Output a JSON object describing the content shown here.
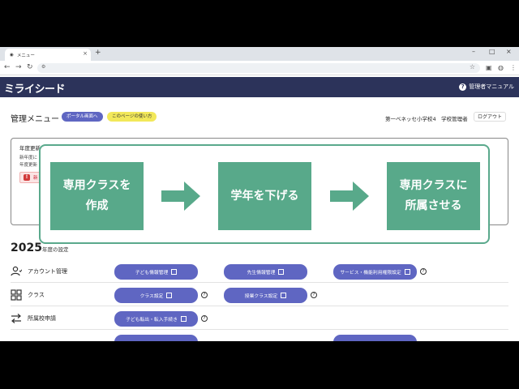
{
  "browser": {
    "tab_title": "メニュー",
    "new_tab": "+"
  },
  "app": {
    "logo": "ミライシード",
    "manual_label": "管理者マニュアル"
  },
  "header": {
    "title": "管理メニュー",
    "portal_button": "ポータル画面へ",
    "howto_button": "このページの使い方",
    "school": "第一ベネッセ小学校4　学校管理者",
    "logout": "ログアウト"
  },
  "year_update": {
    "title": "年度更新",
    "line1": "新年度に",
    "line2": "年度更新",
    "warn_text": "新"
  },
  "flow": {
    "step1_line1": "専用クラスを",
    "step1_line2": "作成",
    "step2_line1": "学年を下げる",
    "step3_line1": "専用クラスに",
    "step3_line2": "所属させる",
    "accent_color": "#58a98a"
  },
  "settings": {
    "year": "2025",
    "year_suffix": "年度の設定",
    "rows": [
      {
        "label": "アカウント管理",
        "buttons": [
          "子ども情報管理",
          "先生情報管理",
          "サービス・機能利用権限設定"
        ]
      },
      {
        "label": "クラス",
        "buttons": [
          "クラス設定",
          "授業クラス設定"
        ]
      },
      {
        "label": "所属校申請",
        "buttons": [
          "子ども転出・転入手続き"
        ]
      }
    ]
  },
  "colors": {
    "header_bg": "#2c335a",
    "button": "#5f66c2",
    "howto_pill": "#f2e85a"
  }
}
